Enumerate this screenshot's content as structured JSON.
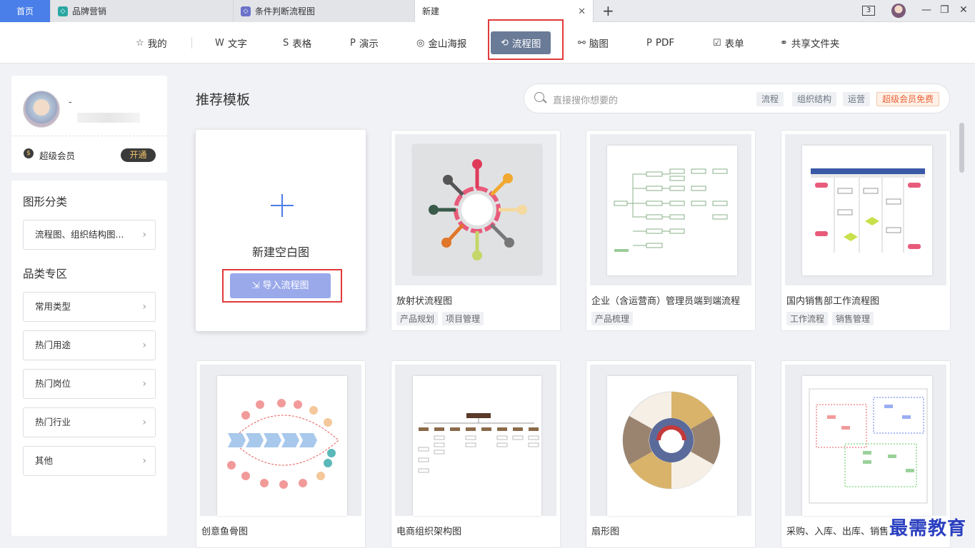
{
  "tabs": {
    "home": "首页",
    "tab1": "品牌营销",
    "tab2": "条件判断流程图",
    "tab3": "新建",
    "window_count": "3"
  },
  "toolbar": {
    "items": [
      {
        "label": "我的",
        "icon": "star-icon"
      },
      {
        "label": "文字",
        "icon": "word-icon"
      },
      {
        "label": "表格",
        "icon": "sheet-icon"
      },
      {
        "label": "演示",
        "icon": "slide-icon"
      },
      {
        "label": "金山海报",
        "icon": "poster-icon"
      },
      {
        "label": "流程图",
        "icon": "flowchart-icon"
      },
      {
        "label": "脑图",
        "icon": "mindmap-icon"
      },
      {
        "label": "PDF",
        "icon": "pdf-icon"
      },
      {
        "label": "表单",
        "icon": "form-icon"
      },
      {
        "label": "共享文件夹",
        "icon": "share-icon"
      }
    ],
    "active": "流程图"
  },
  "user": {
    "name": "-",
    "vip_label": "超级会员",
    "vip_button": "开通"
  },
  "sidebar": {
    "graphic_head": "图形分类",
    "graphic_btn": "流程图、组织结构图...",
    "category_head": "品类专区",
    "categories": [
      "常用类型",
      "热门用途",
      "热门岗位",
      "热门行业",
      "其他"
    ]
  },
  "main": {
    "title": "推荐模板",
    "search_placeholder": "直接搜你想要的",
    "search_tags": [
      "流程",
      "组织结构",
      "运营"
    ],
    "search_vip_tag": "超级会员免费",
    "blank_label": "新建空白图",
    "import_label": "导入流程图",
    "templates": [
      {
        "title": "放射状流程图",
        "tags": [
          "产品规划",
          "项目管理"
        ]
      },
      {
        "title": "企业（含运营商）管理员端到端流程",
        "tags": [
          "产品梳理"
        ]
      },
      {
        "title": "国内销售部工作流程图",
        "tags": [
          "工作流程",
          "销售管理"
        ]
      },
      {
        "title": "创意鱼骨图",
        "tags": []
      },
      {
        "title": "电商组织架构图",
        "tags": []
      },
      {
        "title": "扇形图",
        "tags": []
      },
      {
        "title": "采购、入库、出库、销售",
        "tags": []
      }
    ]
  },
  "watermark": "最需教育",
  "colors": {
    "accent": "#4a7ee8",
    "active_tab": "#6a7b97",
    "highlight": "#e03a3a"
  }
}
